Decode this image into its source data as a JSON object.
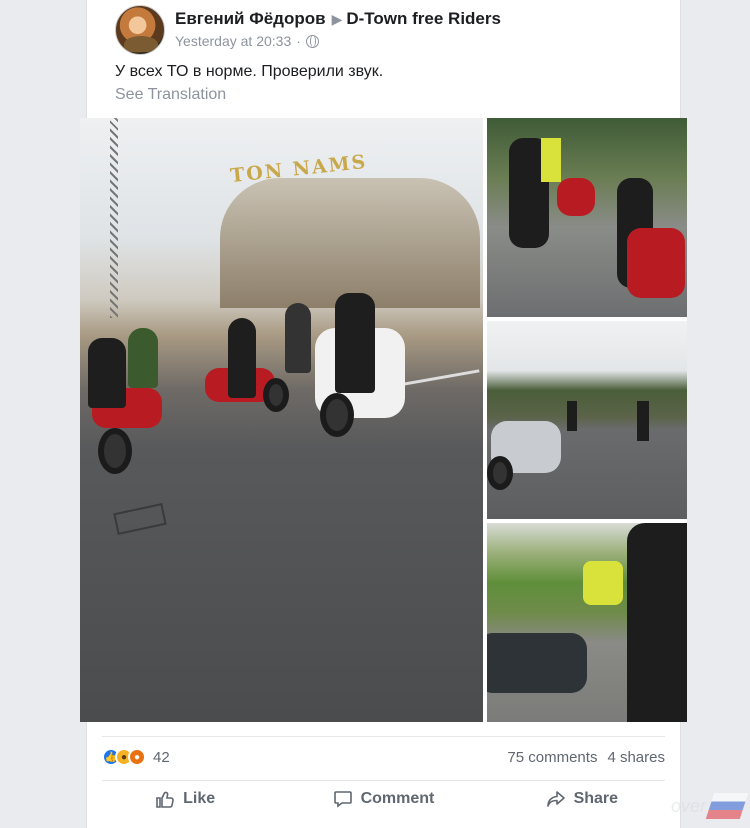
{
  "post": {
    "author": "Евгений Фёдоров",
    "group": "D-Town free Riders",
    "time": "Yesterday at 20:33",
    "text": "У всех ТО в норме. Проверили звук.",
    "see_translation": "See Translation",
    "audience_icon": "globe-icon"
  },
  "photos": {
    "main_sign_text": "TON NAMS",
    "count": 4
  },
  "footer": {
    "reaction_icons": [
      "like-icon",
      "wow-icon",
      "angry-icon"
    ],
    "reaction_count": "42",
    "comments": "75 comments",
    "shares": "4 shares",
    "actions": {
      "like": "Like",
      "comment": "Comment",
      "share": "Share"
    }
  },
  "watermark": {
    "text": "over"
  },
  "colors": {
    "background": "#e9ebee",
    "card": "#ffffff",
    "text": "#1c1e21",
    "muted": "#8d949e",
    "like_blue": "#1877f2"
  }
}
